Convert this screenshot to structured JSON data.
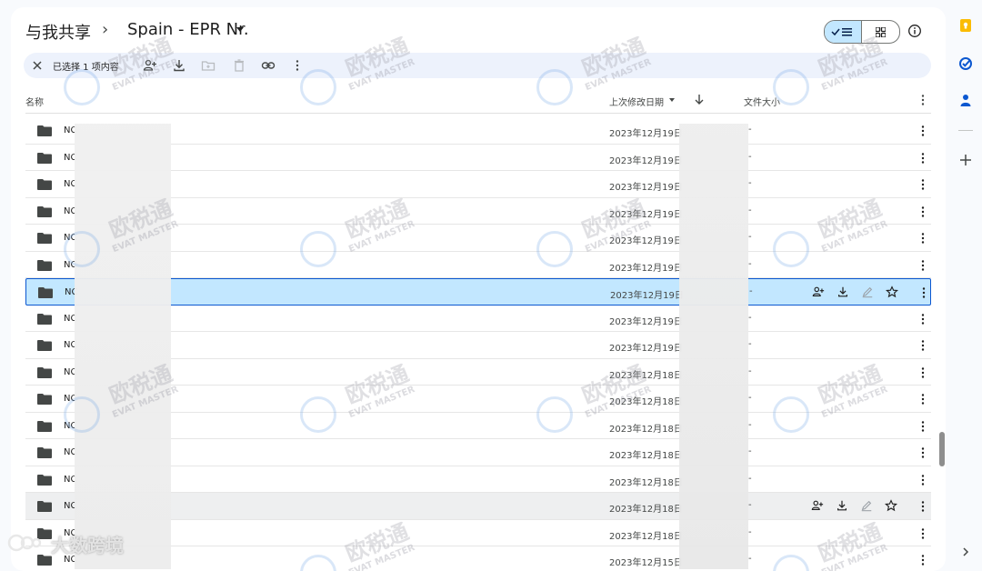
{
  "header": {
    "breadcrumb_root": "与我共享",
    "breadcrumb_sep": "›",
    "folder_title": "Spain - EPR Nr."
  },
  "toolbar": {
    "selection_text": "已选择 1 项内容"
  },
  "columns": {
    "name": "名称",
    "modified": "上次修改日期",
    "size": "文件大小"
  },
  "rows": [
    {
      "name": "NC",
      "date": "2023年12月19日",
      "size": "-"
    },
    {
      "name": "NC",
      "date": "2023年12月19日",
      "size": "-"
    },
    {
      "name": "NC",
      "date": "2023年12月19日",
      "size": "-"
    },
    {
      "name": "NC",
      "date": "2023年12月19日",
      "size": "-"
    },
    {
      "name": "NC",
      "date": "2023年12月19日",
      "size": "-"
    },
    {
      "name": "NC",
      "date": "2023年12月19日",
      "size": "-"
    },
    {
      "name": "NC",
      "date": "2023年12月19日",
      "size": "-"
    },
    {
      "name": "NC",
      "date": "2023年12月19日",
      "size": "-"
    },
    {
      "name": "NC",
      "date": "2023年12月19日",
      "size": "-"
    },
    {
      "name": "NC",
      "date": "2023年12月18日",
      "size": "-"
    },
    {
      "name": "NC",
      "date": "2023年12月18日",
      "size": "-"
    },
    {
      "name": "NC",
      "date": "2023年12月18日",
      "size": "-"
    },
    {
      "name": "NC",
      "date": "2023年12月18日",
      "size": "-"
    },
    {
      "name": "NC",
      "date": "2023年12月18日",
      "size": "-"
    },
    {
      "name": "NC",
      "date": "2023年12月18日",
      "size": "-"
    },
    {
      "name": "NC",
      "date": "2023年12月18日",
      "size": "-"
    },
    {
      "name": "NC",
      "date": "2023年12月15日",
      "size": "-"
    }
  ],
  "watermark": {
    "cn": "欧税通",
    "en": "EVAT MASTER",
    "corner": "大数跨境"
  },
  "colors": {
    "selected_row": "#c2e7ff",
    "selected_border": "#0b57d0",
    "toolbar_bg": "#edf2fc",
    "keep_yellow": "#fbbc04",
    "tasks_blue": "#0b57d0"
  }
}
